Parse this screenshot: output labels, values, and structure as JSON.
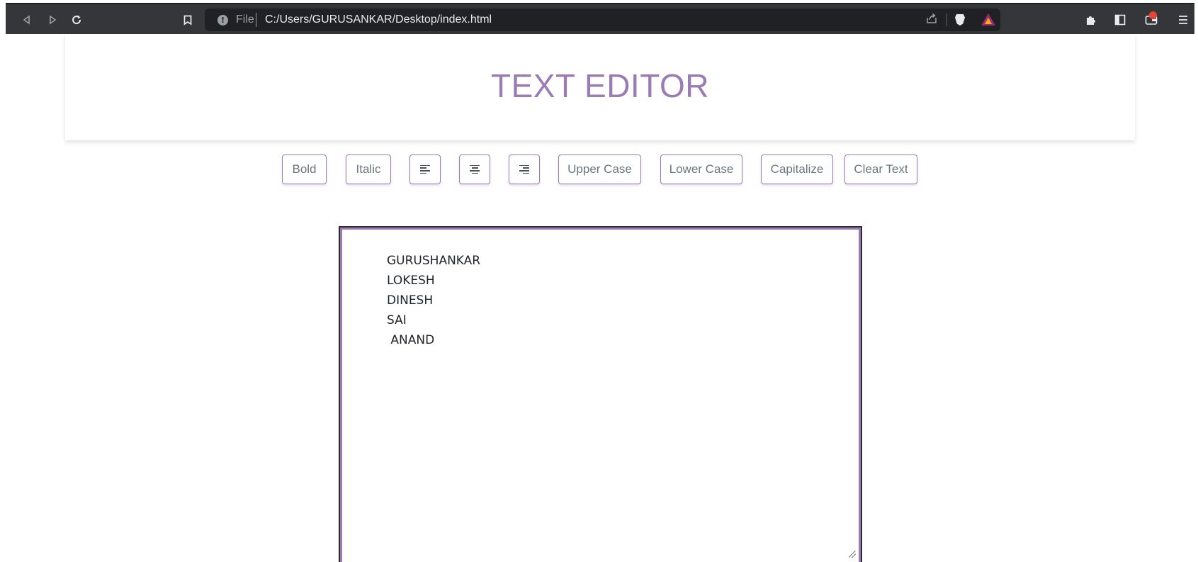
{
  "browser": {
    "scheme_label": "File",
    "url": "C:/Users/GURUSANKAR/Desktop/index.html",
    "info_glyph": "!",
    "icons": [
      "back-icon",
      "forward-icon",
      "reload-icon",
      "bookmark-icon",
      "info-icon",
      "share-icon",
      "brave-shields-icon",
      "brave-rewards-icon",
      "extensions-icon",
      "sidebar-icon",
      "wallet-icon",
      "menu-icon"
    ]
  },
  "header": {
    "title": "TEXT EDITOR"
  },
  "toolbar": {
    "bold": "Bold",
    "italic": "Italic",
    "upper": "Upper Case",
    "lower": "Lower Case",
    "capitalize": "Capitalize",
    "clear": "Clear Text"
  },
  "editor": {
    "lines": [
      "GURUSHANKAR",
      "LOKESH",
      "DINESH",
      "SAI",
      " ANAND"
    ]
  },
  "colors": {
    "accent": "#9b7bb3",
    "chrome": "#35363a",
    "omnibox": "#202124"
  }
}
